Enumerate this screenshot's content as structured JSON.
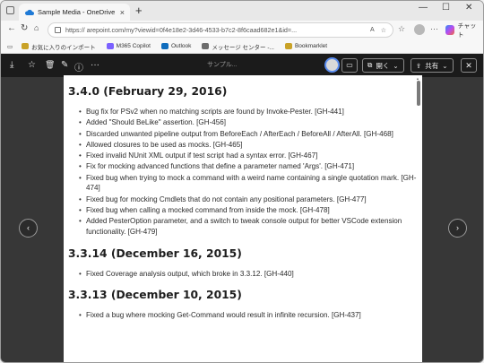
{
  "browser": {
    "tab_title": "Sample Media - OneDrive",
    "tab_close": "×",
    "new_tab": "+",
    "url": "https://                    arepoint.com/my?viewid=0f4e18e2-3d46-4533-b7c2-8f6caad682e1&id=...",
    "copilot_label": "チャット",
    "bookmarks": [
      {
        "label": "お気に入りのインポート",
        "color": "#c9a227"
      },
      {
        "label": "M365 Copilot",
        "color": "#7b61ff"
      },
      {
        "label": "Outlook",
        "color": "#0f6cbd"
      },
      {
        "label": "メッセージ センター -...",
        "color": "#6c6c6c"
      },
      {
        "label": "Bookmarklet",
        "color": "#c9a227"
      }
    ]
  },
  "viewer": {
    "open_label": "開く",
    "share_label": "共有",
    "dim_title": "サンプル..."
  },
  "document": {
    "sections": [
      {
        "heading": "3.4.0 (February 29, 2016)",
        "items": [
          "Bug fix for PSv2 when no matching scripts are found by Invoke-Pester. [GH-441]",
          "Added \"Should BeLike\" assertion. [GH-456]",
          "Discarded unwanted pipeline output from BeforeEach / AfterEach / BeforeAll / AfterAll. [GH-468]",
          "Allowed closures to be used as mocks. [GH-465]",
          "Fixed invalid NUnit XML output if test script had a syntax error. [GH-467]",
          "Fix for mocking advanced functions that define a parameter named 'Args'. [GH-471]",
          "Fixed bug when trying to mock a command with a weird name containing a single quotation mark. [GH-474]",
          "Fixed bug for mocking Cmdlets that do not contain any positional parameters. [GH-477]",
          "Fixed bug when calling a mocked command from inside the mock. [GH-478]",
          "Added PesterOption parameter, and a switch to tweak console output for better VSCode extension functionality. [GH-479]"
        ]
      },
      {
        "heading": "3.3.14 (December 16, 2015)",
        "items": [
          "Fixed Coverage analysis output, which broke in 3.3.12. [GH-440]"
        ]
      },
      {
        "heading": "3.3.13 (December 10, 2015)",
        "items": [
          "Fixed a bug where mocking Get-Command would result in infinite recursion. [GH-437]"
        ]
      }
    ]
  },
  "icons": {
    "download": "⤓",
    "favorite": "☆",
    "delete": "🗑",
    "edit": "✎",
    "info": "ⓘ",
    "more": "···",
    "prev": "‹",
    "next": "›"
  },
  "colors": {
    "viewer_bg": "#1f1f1f",
    "accent": "#5b8def"
  }
}
